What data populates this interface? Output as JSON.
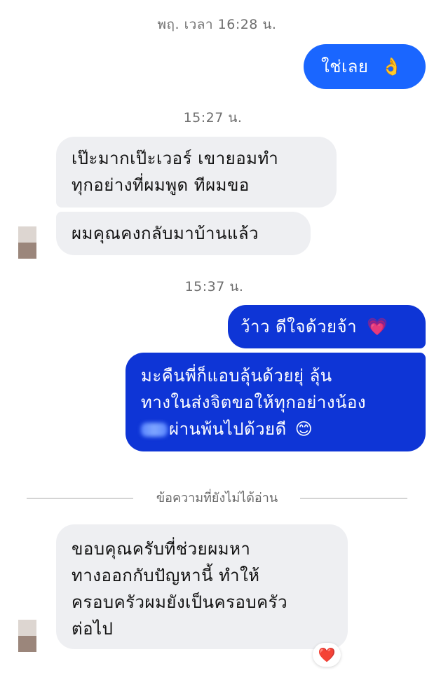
{
  "timestamps": {
    "t1": "พฤ. เวลา 16:28 น.",
    "t2": "15:27 น.",
    "t3": "15:37 น."
  },
  "messages": {
    "m1": {
      "text": "ใช่เลย",
      "emoji": "👌"
    },
    "m2": {
      "lines": [
        "เป๊ะมากเป๊ะเวอร์  เขายอมทำ",
        "ทุกอย่างที่ผมพูด ทีผมขอ"
      ]
    },
    "m3": {
      "text": "ผมคุณคงกลับมาบ้านแล้ว"
    },
    "m4": {
      "text": "ว้าว ดีใจด้วยจ้า",
      "emoji": "💗"
    },
    "m5": {
      "lines": [
        "มะคืนพี่ก็แอบลุ้นด้วยยุ่ ลุ้น",
        "ทางในส่งจิตขอให้ทุกอย่างน้อง",
        "ผ่านพ้นไปด้วยดี"
      ],
      "emoji": "😊"
    },
    "m6": {
      "lines": [
        "ขอบคุณครับที่ช่วยผมหา",
        "ทางออกกับปัญหานี้  ทำให้",
        "ครอบครัวผมยังเป็นครอบครัว",
        "ต่อไป"
      ]
    }
  },
  "divider": {
    "label": "ข้อความที่ยังไม่ได้อ่าน"
  },
  "reaction": {
    "emoji": "❤️"
  },
  "colors": {
    "outgoing_light": "#1a66ff",
    "outgoing_dark": "#0e35d6",
    "incoming": "#eeeff2"
  }
}
